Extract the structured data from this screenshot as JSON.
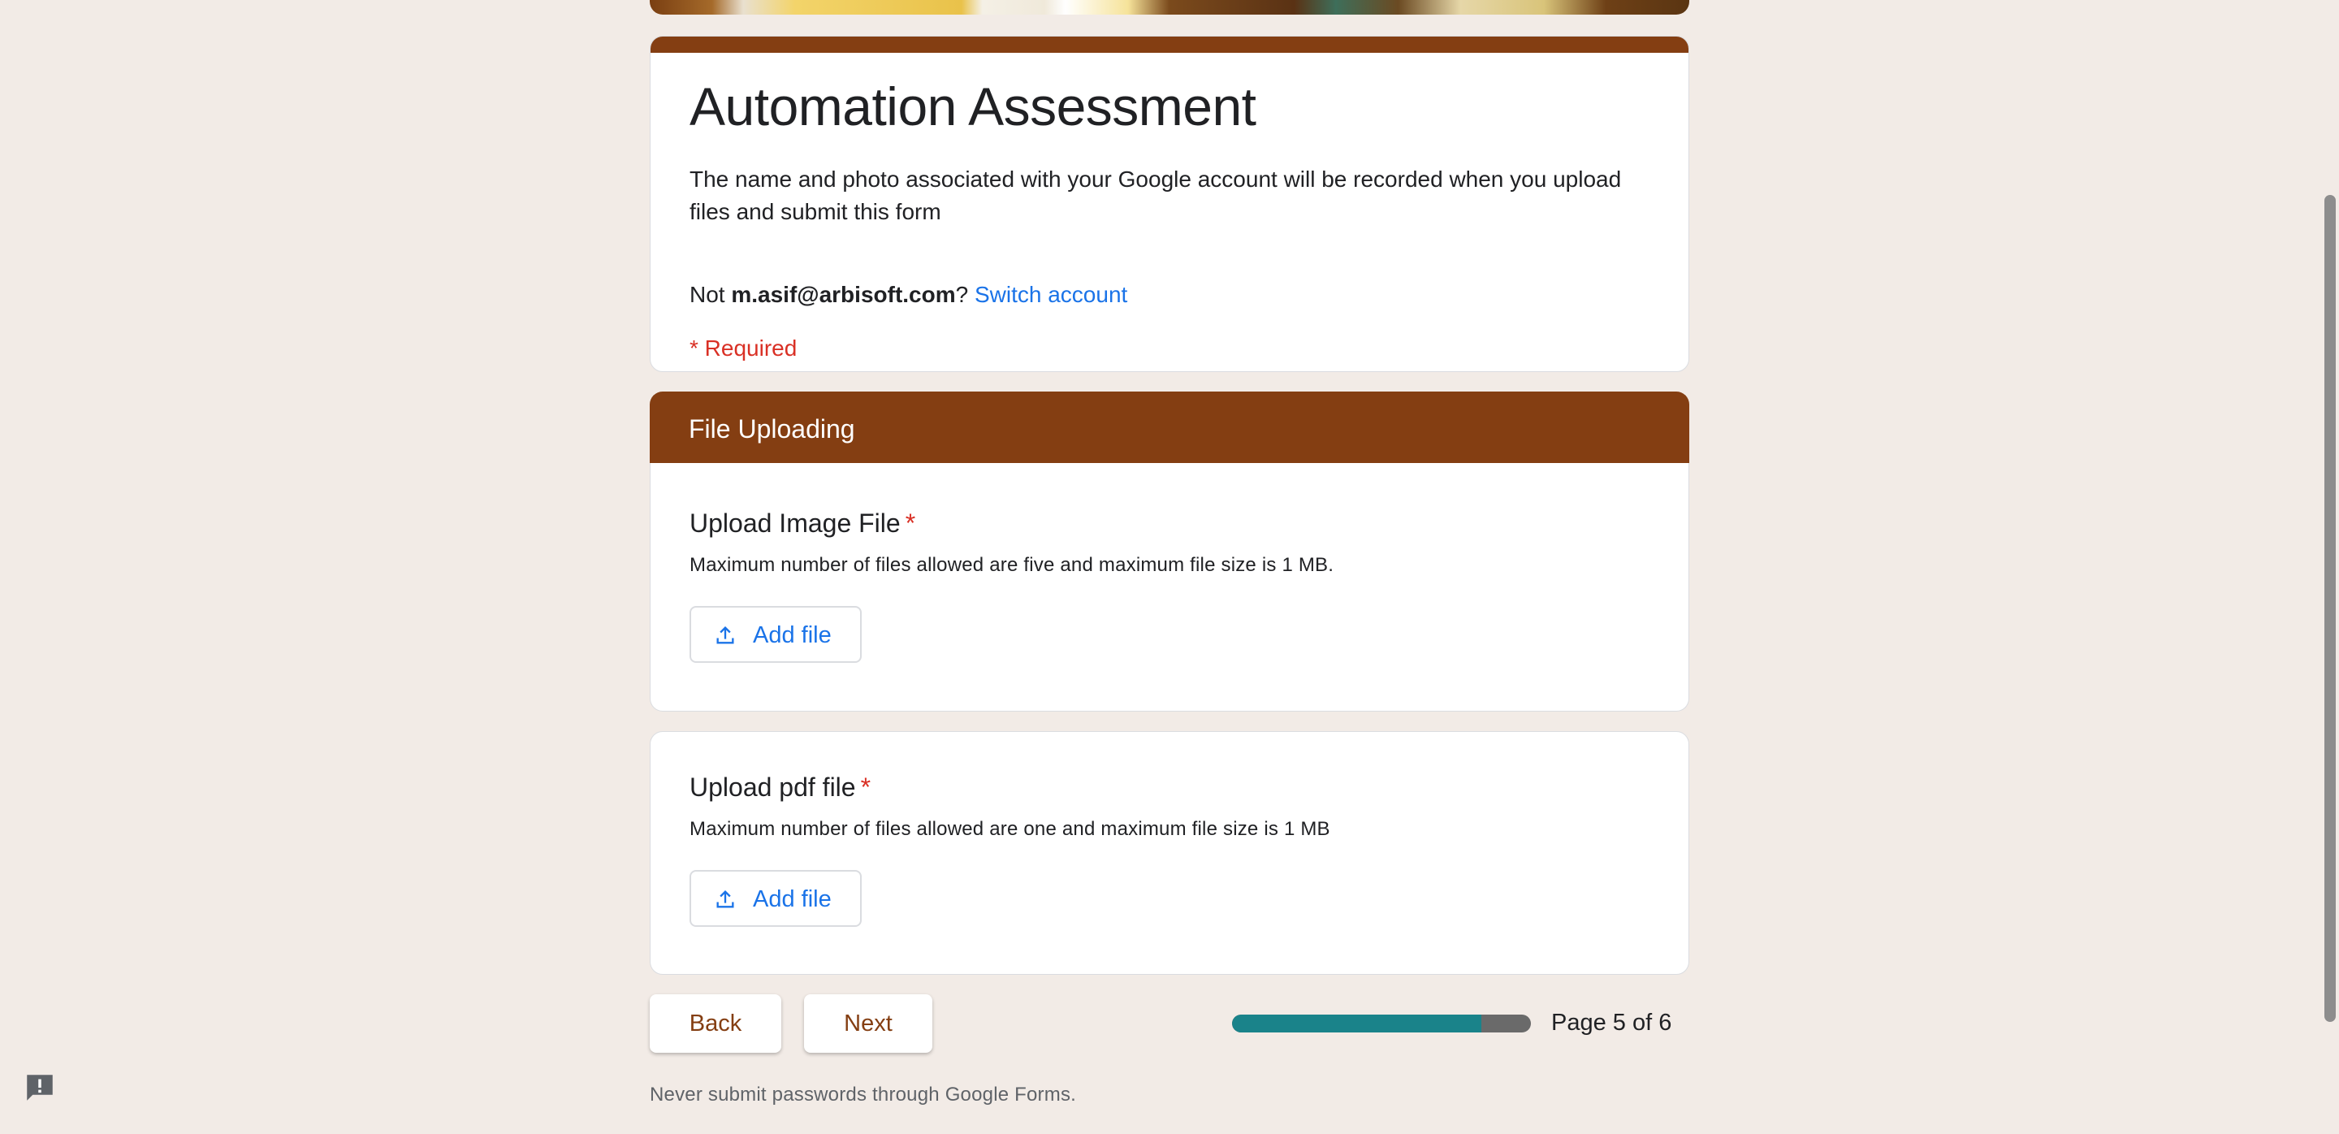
{
  "form": {
    "title": "Automation Assessment",
    "description": "The name and photo associated with your Google account will be recorded when you upload files and submit this form",
    "account_prefix": "Not ",
    "account_email": "m.asif@arbisoft.com",
    "account_suffix": "?",
    "switch_account": "Switch account",
    "required_note": "* Required"
  },
  "section": {
    "title": "File Uploading"
  },
  "questions": [
    {
      "title": "Upload Image File",
      "required_mark": "*",
      "help": "Maximum number of files allowed are five and maximum file size is 1 MB.",
      "button_label": "Add file",
      "button_icon": "upload-icon"
    },
    {
      "title": "Upload pdf file",
      "required_mark": "*",
      "help": "Maximum number of files allowed are one and maximum file size is 1 MB",
      "button_label": "Add file",
      "button_icon": "upload-icon"
    }
  ],
  "navigation": {
    "back_label": "Back",
    "next_label": "Next",
    "progress_fraction": 0.833,
    "page_label": "Page 5 of 6"
  },
  "footer": {
    "note": "Never submit passwords through Google Forms."
  },
  "theme": {
    "accent": "#843e12",
    "link": "#1a73e8",
    "required": "#d93025",
    "progress_fill": "#1a838a",
    "background": "#f2ebe6"
  },
  "icons": {
    "feedback": "report-icon",
    "upload": "upload-icon"
  }
}
